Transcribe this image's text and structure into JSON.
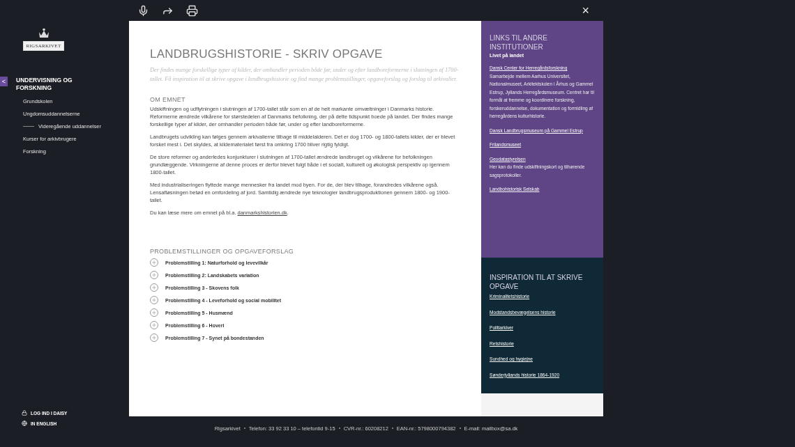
{
  "logo": {
    "label": "RIGSARKIVET"
  },
  "sidebar": {
    "back_button": "<",
    "section_title": "UNDERVISNING OG FORSKNING",
    "items": [
      {
        "label": "Grundskolen"
      },
      {
        "label": "Ungdomsuddannelserne",
        "children": [
          {
            "label": "Videregående uddannelser"
          }
        ]
      },
      {
        "label": "Kurser for arkivbrugere"
      },
      {
        "label": "Forskning"
      }
    ],
    "bottom_links": [
      {
        "kind": "login",
        "label": "LOG IND I DAISY"
      },
      {
        "kind": "language",
        "label": "IN ENGLISH"
      }
    ]
  },
  "toolbar": {
    "close": "×"
  },
  "article": {
    "title": "LANDBRUGSHISTORIE - SKRIV OPGAVE",
    "intro": "Der findes mange forskellige typer af kilder, der omhandler perioden både før, under og efter landboreformerne i slutningen af 1700-tallet. Få inspiration til at skrive opgave i landbrugshistorie og find mange problemstillinger, opgaveforslag og forslag til arkivalier.",
    "section_title": "OM EMNET",
    "paragraphs": [
      "Udskiftningen og udflytningen i slutningen af 1700-tallet står som en af de helt markante omvæltninger i Danmarks historie. Reformerne ændrede vilkårene for størstedelen af Danmarks befolkning, der på dette tidspunkt boede på landet. Der findes mange forskellige typer af kilder, der omhandler perioden både før, under og efter landboreformerne.",
      "Landbrugets udvikling kan følges gennem arkivalierne tilbage til middelalderen. Det er dog 1700- og 1800-tallets kilder, der er blevet forsket mest i. Det skyldes, at kildematerialet først fra omkring 1700 bliver rigtig fyldigt.",
      "De store reformer og anderledes konjunkturer i slutningen af 1700-tallet ændrede landbruget og vilkårene for befolkningen grundlæggende. Virkningerne af denne proces er derfor blevet fulgt både i et socialt, kulturelt og økologisk perspektiv op igennem 1800-tallet.",
      "Med industrialiseringen flyttede mange mennesker fra landet mod byen. For de, der blev tilbage, forandredes vilkårene også. Lensafløsningen betød en omfordeling af jord. Samtidig ændrede nye teknologier landbrugsproduktionen gennem 1800- og 1900-tallet."
    ],
    "more": {
      "text": "Du kan læse mere om emnet på bl.a.",
      "link": "danmarkshistorien.dk",
      "after": "."
    },
    "problems_title": "PROBLEMSTILLINGER OG OPGAVEFORSLAG",
    "problems": [
      "Problemstilling 1: Naturforhold og levevilkår",
      "Problemstilling 2: Landskabets variation",
      "Problemstilling 3 - Skovens folk",
      "Problemstilling 4 - Leveforhold og social mobilitet",
      "Problemstilling 5 - Husmænd",
      "Problemstilling 6 - Hoveri",
      "Problemstilling 7 - Synet på bondestanden"
    ]
  },
  "links_box": {
    "title": "LINKS TIL ANDRE INSTITUTIONER",
    "subtitle": "Livet på landet",
    "links": [
      {
        "label": "Dansk Center for Herregårdsforskning",
        "description": "Samarbejde mellem Aarhus Universitet, Nationalmuseet, Arkitektskolen i Århus og Gammel Estrup, Jyllands Herregårdsmuseum. Centret har til formål at fremme og koordinere forskning, forskeruddannelse, dokumentation og formidling af herregårdens kulturhistorie."
      },
      {
        "label": "Dansk Landbrugsmuseum på Gammel Estrup"
      },
      {
        "label": "Frilandsmuseet"
      },
      {
        "label": "Geodatastyrelsen",
        "description": "Her kan du finde udskiftningskort og tilhørende sagsprotokoller."
      },
      {
        "label": "Landbohistorisk Selskab"
      }
    ]
  },
  "inspiration_box": {
    "title": "INSPIRATION TIL AT SKRIVE OPGAVE",
    "links": [
      "Kriminalitetshistorie",
      "Modstandsbevægelsens historie",
      "Politiarkiver",
      "Retshistorie",
      "Sundhed og hygiejne",
      "Sønderjyllands historie 1864-1920"
    ]
  },
  "footer": [
    "Rigsarkivet",
    "Telefon: 33 92 33 10 – telefontid 9-15",
    "CVR-nr.: 60208212",
    "EAN-nr.: 5798000794382",
    "E-mail: mailbox@sa.dk"
  ]
}
